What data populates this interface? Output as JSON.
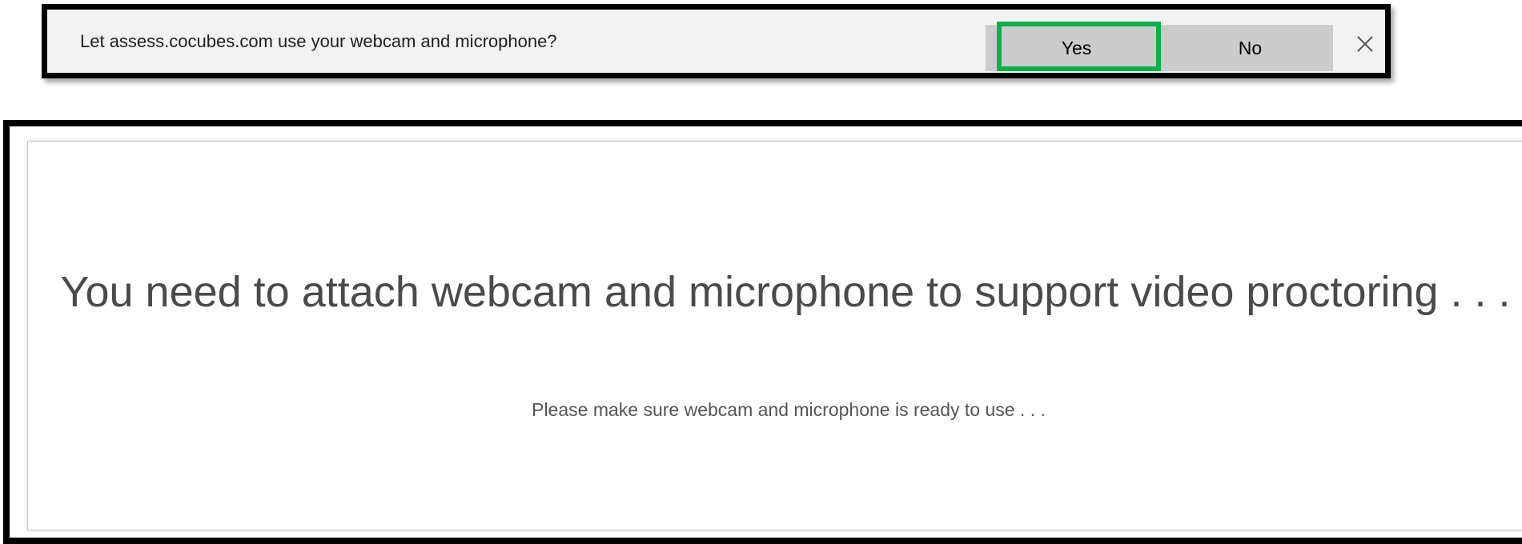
{
  "permission_prompt": {
    "message": "Let assess.cocubes.com use your webcam and microphone?",
    "yes_label": "Yes",
    "no_label": "No",
    "close_icon": "close-icon",
    "highlight_color": "#0ab04a"
  },
  "notice": {
    "headline": "You need to attach webcam and microphone to support video proctoring . . .",
    "subtext": "Please make sure webcam and microphone is ready to use . . ."
  }
}
